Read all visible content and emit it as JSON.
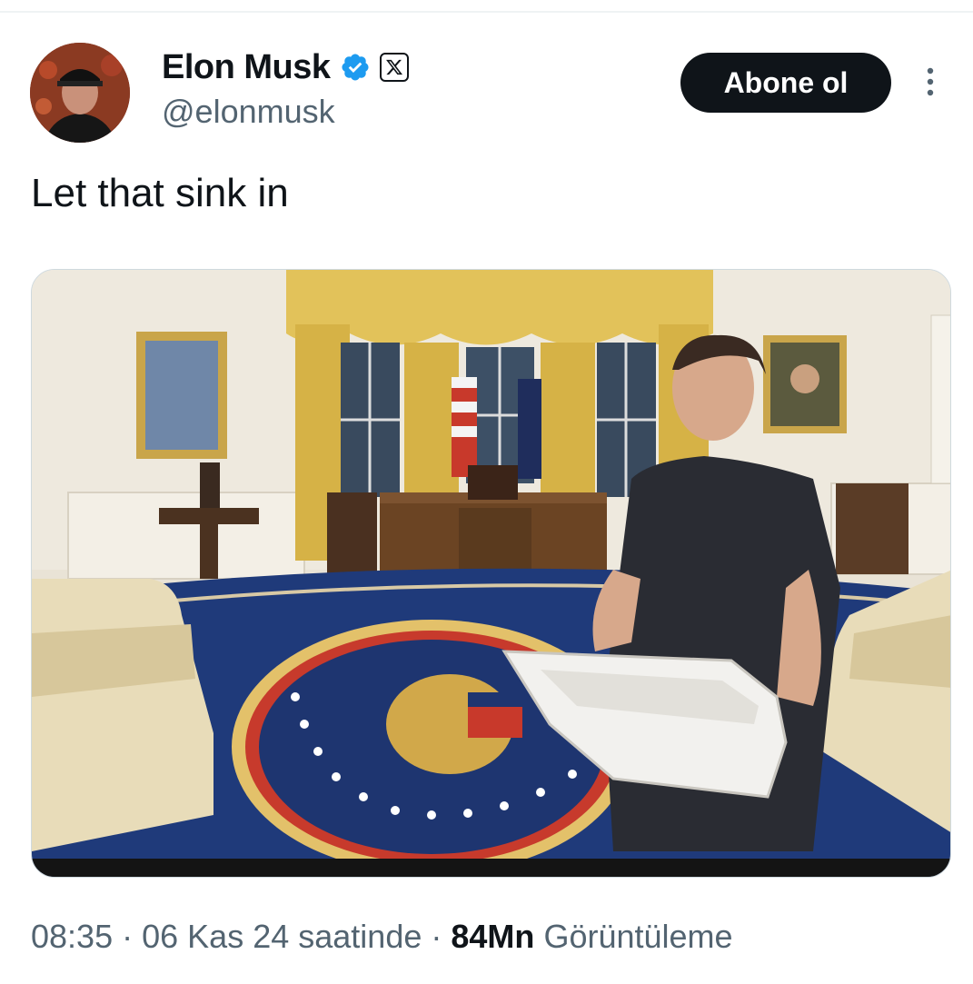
{
  "author": {
    "display_name": "Elon Musk",
    "handle": "@elonmusk",
    "verified_icon": "verified-badge-icon",
    "affiliation_icon": "x-logo-icon",
    "verified_color": "#1d9bf0"
  },
  "actions": {
    "follow_label": "Abone ol",
    "more_icon": "more-vertical-icon"
  },
  "tweet": {
    "text": "Let that sink in"
  },
  "meta": {
    "time": "08:35",
    "separator": "·",
    "date": "06 Kas 24 saatinde",
    "views_count": "84Mn",
    "views_label": "Görüntüleme"
  },
  "colors": {
    "text_primary": "#0f1419",
    "text_secondary": "#536471",
    "button_bg": "#0f1419"
  }
}
